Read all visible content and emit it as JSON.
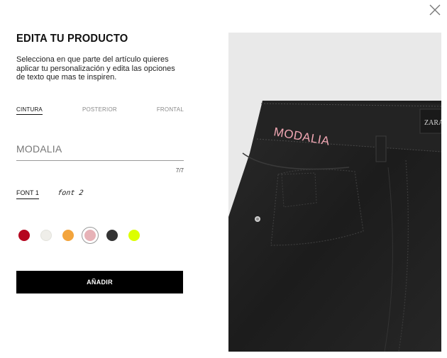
{
  "panel": {
    "title": "EDITA TU PRODUCTO",
    "description": "Selecciona en que parte del artículo quieres aplicar tu personalización y edita las opciones de texto que mas te inspiren."
  },
  "tabs": [
    {
      "label": "CINTURA",
      "active": true
    },
    {
      "label": "POSTERIOR",
      "active": false
    },
    {
      "label": "FRONTAL",
      "active": false
    }
  ],
  "text_input": {
    "value": "MODALIA",
    "counter": "7/7"
  },
  "fonts": [
    {
      "label": "FONT 1",
      "active": true
    },
    {
      "label": "font 2",
      "active": false
    }
  ],
  "colors": [
    {
      "name": "red",
      "hex": "#b5061f"
    },
    {
      "name": "off-white",
      "hex": "#efeee9"
    },
    {
      "name": "orange",
      "hex": "#f3a43c"
    },
    {
      "name": "pink",
      "hex": "#e7b2b7",
      "selected": true
    },
    {
      "name": "dark-gray",
      "hex": "#333333"
    },
    {
      "name": "neon-yellow",
      "hex": "#dcff00"
    }
  ],
  "add_button": "AÑADIR",
  "preview": {
    "embroidery_text": "MODALIA",
    "embroidery_color": "#f1a7b3",
    "brand_label": "ZARA"
  },
  "icons": {
    "close": "close-icon"
  }
}
